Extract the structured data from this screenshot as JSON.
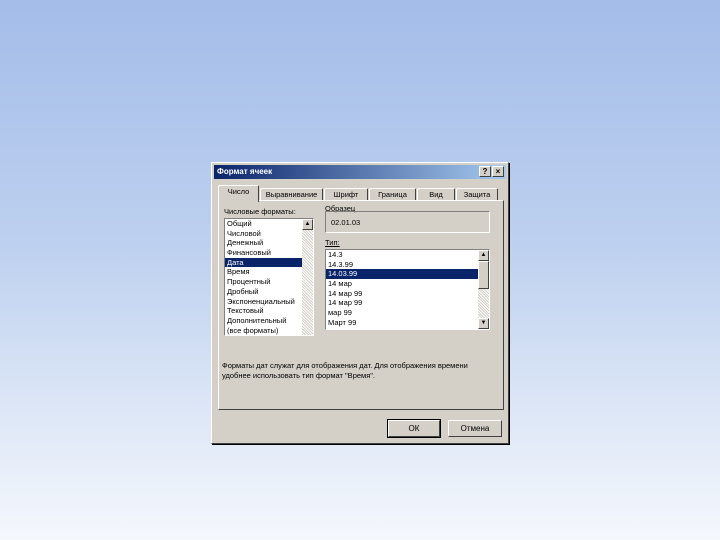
{
  "dialog": {
    "title": "Формат ячеек",
    "help_label": "?",
    "close_label": "×"
  },
  "tabs": [
    {
      "label": "Число",
      "active": true
    },
    {
      "label": "Выравнивание",
      "active": false
    },
    {
      "label": "Шрифт",
      "active": false
    },
    {
      "label": "Граница",
      "active": false
    },
    {
      "label": "Вид",
      "active": false
    },
    {
      "label": "Защита",
      "active": false
    }
  ],
  "formats": {
    "label": "Числовые форматы:",
    "items": [
      "Общий",
      "Числовой",
      "Денежный",
      "Финансовый",
      "Дата",
      "Время",
      "Процентный",
      "Дробный",
      "Экспоненциальный",
      "Текстовый",
      "Дополнительный",
      "(все форматы)"
    ],
    "selected_index": 4
  },
  "sample": {
    "label": "Образец",
    "value": "02.01.03"
  },
  "type": {
    "label": "Тип:",
    "items": [
      "14.3",
      "14.3.99",
      "14.03.99",
      "14 мар",
      "14 мар 99",
      "14 мар 99",
      "мар 99",
      "Март 99"
    ],
    "selected_index": 2
  },
  "description": {
    "line1": "Форматы дат служат для отображения дат. Для отображения времени",
    "line2": "удобнее использовать тип формат \"Время\"."
  },
  "buttons": {
    "ok": "ОК",
    "cancel": "Отмена"
  },
  "colors": {
    "title_start": "#0a246a",
    "title_end": "#a6caf0",
    "selection": "#0a246a",
    "face": "#d4d0c8"
  }
}
